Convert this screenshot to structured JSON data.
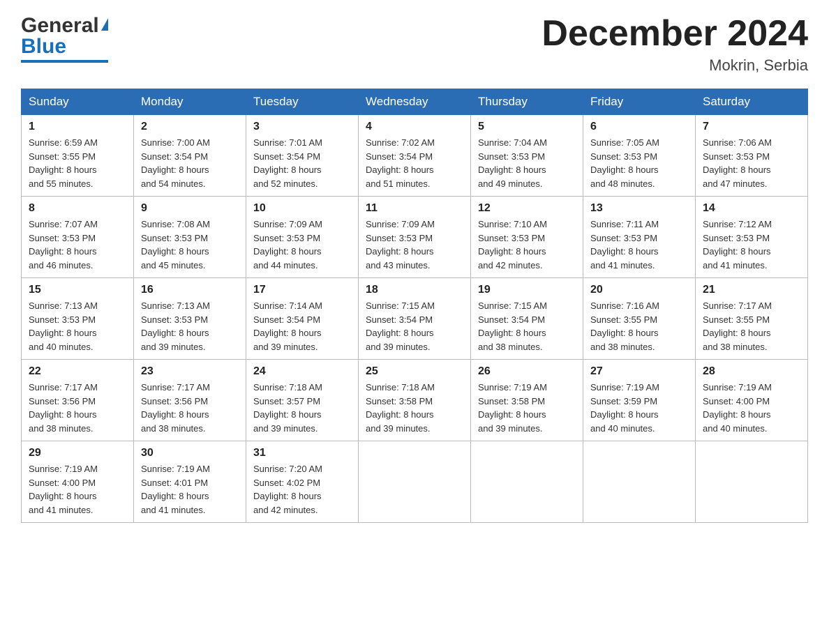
{
  "header": {
    "logo_general": "General",
    "logo_blue": "Blue",
    "month_title": "December 2024",
    "location": "Mokrin, Serbia"
  },
  "days_of_week": [
    "Sunday",
    "Monday",
    "Tuesday",
    "Wednesday",
    "Thursday",
    "Friday",
    "Saturday"
  ],
  "weeks": [
    [
      {
        "day": "1",
        "sunrise": "6:59 AM",
        "sunset": "3:55 PM",
        "daylight": "8 hours and 55 minutes."
      },
      {
        "day": "2",
        "sunrise": "7:00 AM",
        "sunset": "3:54 PM",
        "daylight": "8 hours and 54 minutes."
      },
      {
        "day": "3",
        "sunrise": "7:01 AM",
        "sunset": "3:54 PM",
        "daylight": "8 hours and 52 minutes."
      },
      {
        "day": "4",
        "sunrise": "7:02 AM",
        "sunset": "3:54 PM",
        "daylight": "8 hours and 51 minutes."
      },
      {
        "day": "5",
        "sunrise": "7:04 AM",
        "sunset": "3:53 PM",
        "daylight": "8 hours and 49 minutes."
      },
      {
        "day": "6",
        "sunrise": "7:05 AM",
        "sunset": "3:53 PM",
        "daylight": "8 hours and 48 minutes."
      },
      {
        "day": "7",
        "sunrise": "7:06 AM",
        "sunset": "3:53 PM",
        "daylight": "8 hours and 47 minutes."
      }
    ],
    [
      {
        "day": "8",
        "sunrise": "7:07 AM",
        "sunset": "3:53 PM",
        "daylight": "8 hours and 46 minutes."
      },
      {
        "day": "9",
        "sunrise": "7:08 AM",
        "sunset": "3:53 PM",
        "daylight": "8 hours and 45 minutes."
      },
      {
        "day": "10",
        "sunrise": "7:09 AM",
        "sunset": "3:53 PM",
        "daylight": "8 hours and 44 minutes."
      },
      {
        "day": "11",
        "sunrise": "7:09 AM",
        "sunset": "3:53 PM",
        "daylight": "8 hours and 43 minutes."
      },
      {
        "day": "12",
        "sunrise": "7:10 AM",
        "sunset": "3:53 PM",
        "daylight": "8 hours and 42 minutes."
      },
      {
        "day": "13",
        "sunrise": "7:11 AM",
        "sunset": "3:53 PM",
        "daylight": "8 hours and 41 minutes."
      },
      {
        "day": "14",
        "sunrise": "7:12 AM",
        "sunset": "3:53 PM",
        "daylight": "8 hours and 41 minutes."
      }
    ],
    [
      {
        "day": "15",
        "sunrise": "7:13 AM",
        "sunset": "3:53 PM",
        "daylight": "8 hours and 40 minutes."
      },
      {
        "day": "16",
        "sunrise": "7:13 AM",
        "sunset": "3:53 PM",
        "daylight": "8 hours and 39 minutes."
      },
      {
        "day": "17",
        "sunrise": "7:14 AM",
        "sunset": "3:54 PM",
        "daylight": "8 hours and 39 minutes."
      },
      {
        "day": "18",
        "sunrise": "7:15 AM",
        "sunset": "3:54 PM",
        "daylight": "8 hours and 39 minutes."
      },
      {
        "day": "19",
        "sunrise": "7:15 AM",
        "sunset": "3:54 PM",
        "daylight": "8 hours and 38 minutes."
      },
      {
        "day": "20",
        "sunrise": "7:16 AM",
        "sunset": "3:55 PM",
        "daylight": "8 hours and 38 minutes."
      },
      {
        "day": "21",
        "sunrise": "7:17 AM",
        "sunset": "3:55 PM",
        "daylight": "8 hours and 38 minutes."
      }
    ],
    [
      {
        "day": "22",
        "sunrise": "7:17 AM",
        "sunset": "3:56 PM",
        "daylight": "8 hours and 38 minutes."
      },
      {
        "day": "23",
        "sunrise": "7:17 AM",
        "sunset": "3:56 PM",
        "daylight": "8 hours and 38 minutes."
      },
      {
        "day": "24",
        "sunrise": "7:18 AM",
        "sunset": "3:57 PM",
        "daylight": "8 hours and 39 minutes."
      },
      {
        "day": "25",
        "sunrise": "7:18 AM",
        "sunset": "3:58 PM",
        "daylight": "8 hours and 39 minutes."
      },
      {
        "day": "26",
        "sunrise": "7:19 AM",
        "sunset": "3:58 PM",
        "daylight": "8 hours and 39 minutes."
      },
      {
        "day": "27",
        "sunrise": "7:19 AM",
        "sunset": "3:59 PM",
        "daylight": "8 hours and 40 minutes."
      },
      {
        "day": "28",
        "sunrise": "7:19 AM",
        "sunset": "4:00 PM",
        "daylight": "8 hours and 40 minutes."
      }
    ],
    [
      {
        "day": "29",
        "sunrise": "7:19 AM",
        "sunset": "4:00 PM",
        "daylight": "8 hours and 41 minutes."
      },
      {
        "day": "30",
        "sunrise": "7:19 AM",
        "sunset": "4:01 PM",
        "daylight": "8 hours and 41 minutes."
      },
      {
        "day": "31",
        "sunrise": "7:20 AM",
        "sunset": "4:02 PM",
        "daylight": "8 hours and 42 minutes."
      },
      null,
      null,
      null,
      null
    ]
  ],
  "labels": {
    "sunrise": "Sunrise: ",
    "sunset": "Sunset: ",
    "daylight": "Daylight: "
  }
}
